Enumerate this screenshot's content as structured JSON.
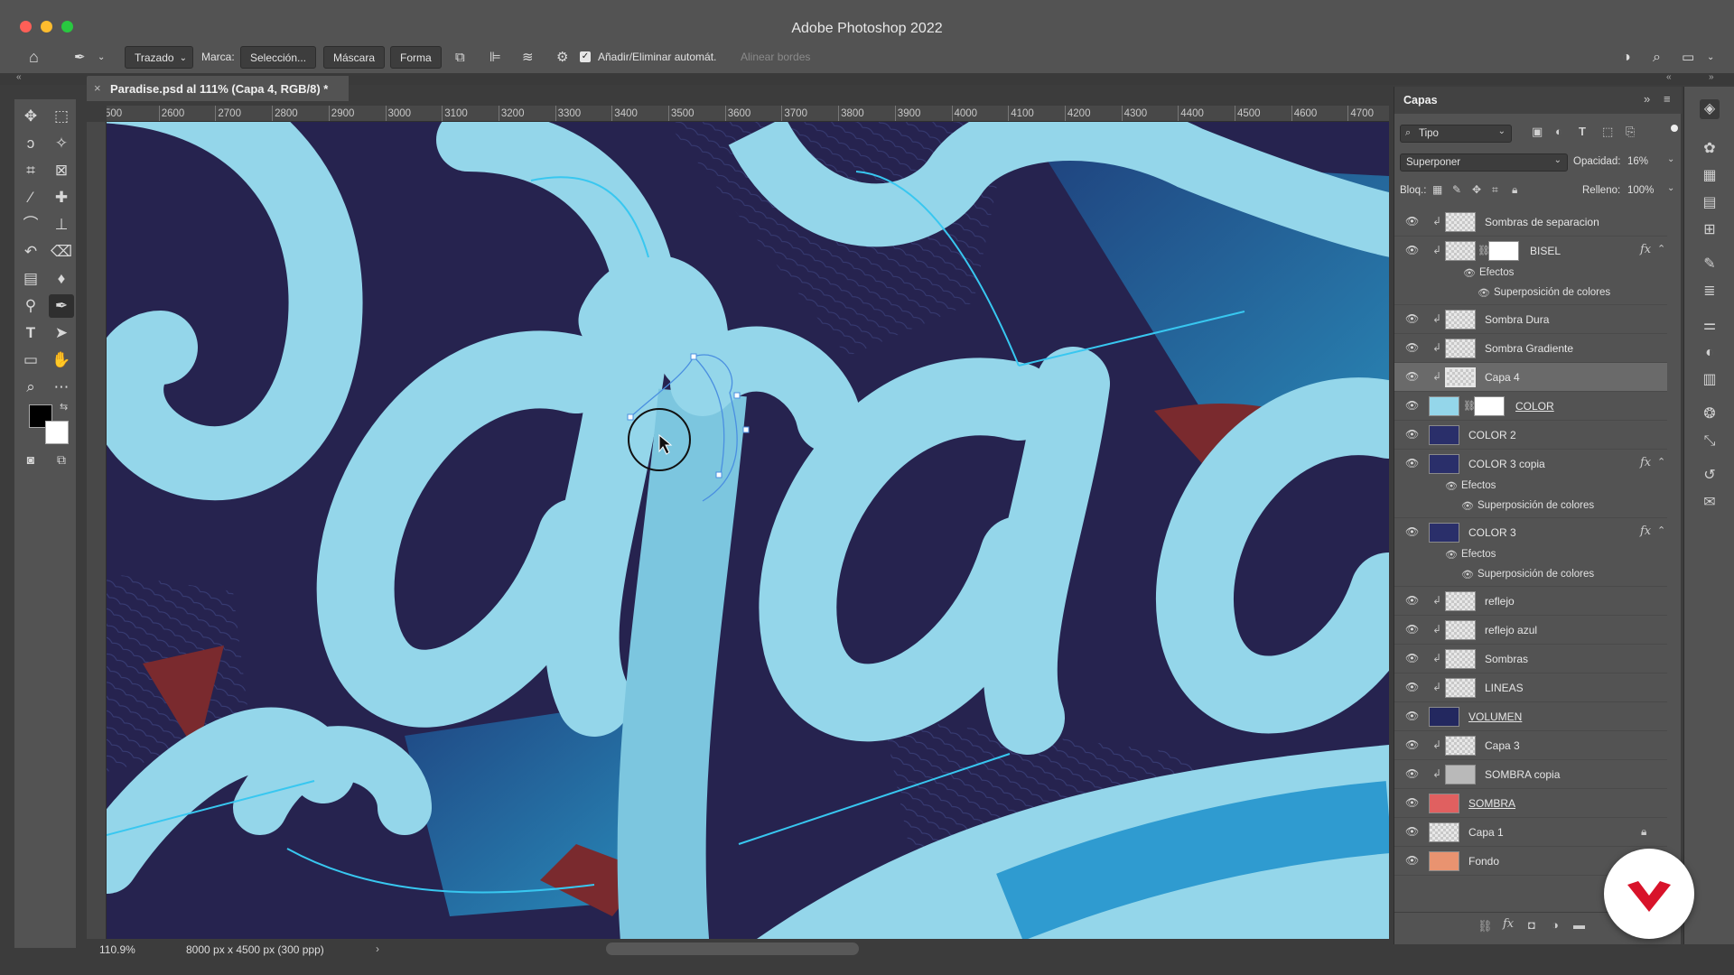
{
  "window": {
    "title": "Adobe Photoshop 2022"
  },
  "options_bar": {
    "mode": "Trazado",
    "mark_label": "Marca:",
    "btn_selection": "Selección...",
    "btn_mask": "Máscara",
    "btn_shape": "Forma",
    "auto_add_delete": "Añadir/Eliminar automát.",
    "align_edges": "Alinear bordes"
  },
  "document": {
    "tab_title": "Paradise.psd al 111% (Capa 4, RGB/8) *",
    "close": "×"
  },
  "ruler": {
    "ticks": [
      "500",
      "2600",
      "2700",
      "2800",
      "2900",
      "3000",
      "3100",
      "3200",
      "3300",
      "3400",
      "3500",
      "3600",
      "3700",
      "3800",
      "3900",
      "4000",
      "4100",
      "4200",
      "4300",
      "4400",
      "4500",
      "4600",
      "4700"
    ]
  },
  "status_bar": {
    "zoom": "110.9%",
    "doc_size": "8000 px x 4500 px (300 ppp)",
    "arrow": "›"
  },
  "layers_panel": {
    "title": "Capas",
    "filter_kind": "Tipo",
    "blend_mode": "Superponer",
    "opacity_label": "Opacidad:",
    "opacity_value": "16%",
    "lock_label": "Bloq.:",
    "fill_label": "Relleno:",
    "fill_value": "100%",
    "layers": [
      {
        "name": "Sombras de separacion"
      },
      {
        "name": "BISEL"
      },
      {
        "effects_label": "Efectos",
        "effect": "Superposición de colores"
      },
      {
        "name": "Sombra Dura"
      },
      {
        "name": "Sombra Gradiente"
      },
      {
        "name": "Capa 4"
      },
      {
        "name": "COLOR"
      },
      {
        "name": "COLOR 2"
      },
      {
        "name": "COLOR 3 copia"
      },
      {
        "effects_label": "Efectos",
        "effect": "Superposición de colores"
      },
      {
        "name": "COLOR 3"
      },
      {
        "effects_label": "Efectos",
        "effect": "Superposición de colores"
      },
      {
        "name": "reflejo"
      },
      {
        "name": "reflejo azul"
      },
      {
        "name": "Sombras"
      },
      {
        "name": "LINEAS"
      },
      {
        "name": "VOLUMEN"
      },
      {
        "name": "Capa 3"
      },
      {
        "name": "SOMBRA copia"
      },
      {
        "name": "SOMBRA"
      },
      {
        "name": "Capa 1"
      },
      {
        "name": "Fondo"
      }
    ]
  },
  "colors": {
    "accent_blue": "#2f9bd0",
    "canvas_navy": "#26234f",
    "letter_light": "#94d6ea",
    "accent_red": "#7a2a2e",
    "brand_red": "#d8132a"
  },
  "icons": {
    "home": "home-icon",
    "pen": "pen-tool-icon",
    "search": "search-icon",
    "layers": "layers-icon",
    "eye": "eye-icon",
    "lock": "lock-icon"
  }
}
